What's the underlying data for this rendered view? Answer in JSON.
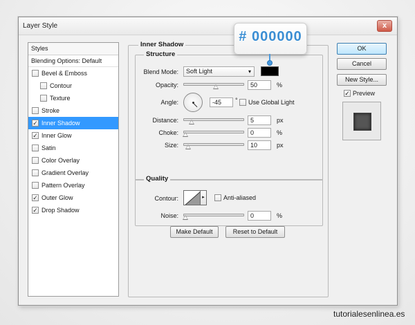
{
  "window": {
    "title": "Layer Style",
    "close_label": "x"
  },
  "styles_list": {
    "header": "Styles",
    "blending_options": "Blending Options: Default",
    "items": [
      {
        "label": "Bevel & Emboss",
        "checked": false,
        "sub": false,
        "active": false
      },
      {
        "label": "Contour",
        "checked": false,
        "sub": true,
        "active": false
      },
      {
        "label": "Texture",
        "checked": false,
        "sub": true,
        "active": false
      },
      {
        "label": "Stroke",
        "checked": false,
        "sub": false,
        "active": false
      },
      {
        "label": "Inner Shadow",
        "checked": true,
        "sub": false,
        "active": true
      },
      {
        "label": "Inner Glow",
        "checked": true,
        "sub": false,
        "active": false
      },
      {
        "label": "Satin",
        "checked": false,
        "sub": false,
        "active": false
      },
      {
        "label": "Color Overlay",
        "checked": false,
        "sub": false,
        "active": false
      },
      {
        "label": "Gradient Overlay",
        "checked": false,
        "sub": false,
        "active": false
      },
      {
        "label": "Pattern Overlay",
        "checked": false,
        "sub": false,
        "active": false
      },
      {
        "label": "Outer Glow",
        "checked": true,
        "sub": false,
        "active": false
      },
      {
        "label": "Drop Shadow",
        "checked": true,
        "sub": false,
        "active": false
      }
    ],
    "check_mark": "✓"
  },
  "panel": {
    "title": "Inner Shadow",
    "structure": {
      "title": "Structure",
      "blend_mode_label": "Blend Mode:",
      "blend_mode_value": "Soft Light",
      "color": "#000000",
      "opacity_label": "Opacity:",
      "opacity_value": "50",
      "opacity_level": 50,
      "opacity_unit": "%",
      "angle_label": "Angle:",
      "angle_value": "-45",
      "angle_unit": "°",
      "use_global_light_label": "Use Global Light",
      "use_global_light": false,
      "distance_label": "Distance:",
      "distance_value": "5",
      "distance_level": 0.1,
      "distance_unit": "px",
      "choke_label": "Choke:",
      "choke_value": "0",
      "choke_level": 0,
      "choke_unit": "%",
      "size_label": "Size:",
      "size_value": "10",
      "size_level": 0.04,
      "size_unit": "px"
    },
    "quality": {
      "title": "Quality",
      "contour_label": "Contour:",
      "anti_aliased_label": "Anti-aliased",
      "anti_aliased": false,
      "noise_label": "Noise:",
      "noise_value": "0",
      "noise_level": 0,
      "noise_unit": "%"
    },
    "make_default_label": "Make Default",
    "reset_default_label": "Reset to Default"
  },
  "buttons": {
    "ok": "OK",
    "cancel": "Cancel",
    "new_style": "New Style...",
    "preview_label": "Preview",
    "preview_checked": true
  },
  "callout": {
    "text": "# 000000",
    "color": "#3b8ed3"
  },
  "watermark": "tutorialesenlinea.es",
  "icons": {
    "dropdown": "▾",
    "contour_dropdown": "▸"
  }
}
